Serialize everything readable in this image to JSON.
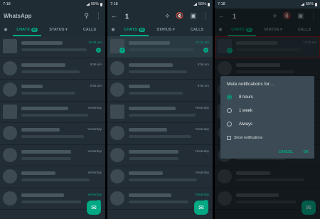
{
  "status": {
    "time": "7:18",
    "battery": "55%"
  },
  "s1": {
    "title": "WhatsApp",
    "tabs": {
      "chats": "CHATS",
      "chats_badge": "99",
      "status": "STATUS ▾",
      "calls": "CALLS"
    },
    "times": [
      "12:34 am",
      "9:56 am",
      "9:55 am",
      "Yesterday",
      "Yesterday",
      "Yesterday",
      "Yesterday",
      "Yesterday"
    ],
    "unread": [
      "5",
      "",
      "",
      "",
      "",
      "",
      "",
      "2"
    ]
  },
  "s2": {
    "count": "1",
    "tabs": {
      "chats": "CHATS",
      "chats_badge": "99",
      "status": "STATUS ▾",
      "calls": "CALLS"
    },
    "times": [
      "12:34 am",
      "9:56 am",
      "9:55 am",
      "Yesterday",
      "Yesterday",
      "Yesterday",
      "Yesterday",
      "Yesterday"
    ],
    "unread": [
      "5",
      "",
      "",
      "",
      "",
      "",
      "",
      "2"
    ]
  },
  "s3": {
    "count": "1",
    "tabs": {
      "chats": "CHATS",
      "chats_badge": "99",
      "status": "STATUS ▾",
      "calls": "CALLS"
    },
    "times": [
      "12:34 am",
      "",
      "",
      "",
      "",
      "",
      "",
      ""
    ],
    "dialog": {
      "title": "Mute notifications for…",
      "options": [
        "8 hours",
        "1 week",
        "Always"
      ],
      "selected": "8 hours",
      "checkbox": "Show notifications",
      "cancel": "CANCEL",
      "ok": "OK"
    }
  },
  "colors": {
    "accent": "#00a884",
    "background": "#232d36",
    "bar": "#1f2c34",
    "dialog": "#3b4a54",
    "selection_outline": "#8b1c1c"
  },
  "icons": [
    "search-icon",
    "more-vert-icon",
    "back-arrow-icon",
    "pin-icon",
    "mute-icon",
    "archive-icon",
    "camera-icon",
    "new-chat-icon",
    "radio-icon",
    "checkbox-icon"
  ]
}
